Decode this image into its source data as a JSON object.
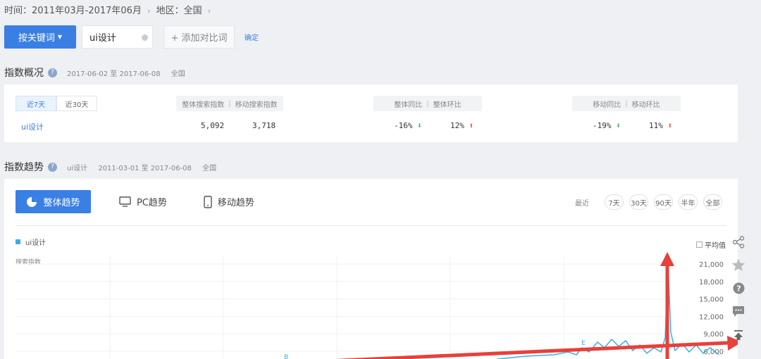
{
  "filter": {
    "time_label": "时间：2011年03月-2017年06月",
    "region_label": "地区：全国",
    "sep": "›"
  },
  "search": {
    "keyword_button": "按关键词",
    "keyword_value": "ui设计",
    "add_compare": "+ 添加对比词",
    "confirm": "确定"
  },
  "overview": {
    "title": "指数概况",
    "date_range": "2017-06-02 至 2017-06-08",
    "region": "全国",
    "tabs": [
      "近7天",
      "近30天"
    ],
    "headers": {
      "search_overall": "整体搜索指数",
      "search_mobile": "移动搜索指数",
      "overall_yoy": "整体同比",
      "overall_mom": "整体环比",
      "mobile_yoy": "移动同比",
      "mobile_mom": "移动环比",
      "bar": "|"
    },
    "row": {
      "keyword": "ui设计",
      "overall_index": "5,092",
      "mobile_index": "3,718",
      "overall_yoy": "-16%",
      "overall_mom": "12%",
      "mobile_yoy": "-19%",
      "mobile_mom": "11%"
    },
    "arrows": {
      "down": "⬇",
      "up": "⬆"
    }
  },
  "trend": {
    "title": "指数趋势",
    "keyword": "ui设计",
    "date_range": "2011-03-01 至 2017-06-08",
    "region": "全国",
    "tabs": [
      "整体趋势",
      "PC趋势",
      "移动趋势"
    ],
    "range_label": "最近",
    "ranges": [
      "7天",
      "30天",
      "90天",
      "半年",
      "全部"
    ],
    "legend": "ui设计",
    "y_title": "搜索指数",
    "avg_label": "平均值",
    "marker_e": "E",
    "marker_b": "B"
  },
  "chart_data": {
    "type": "line",
    "series": [
      {
        "name": "ui设计",
        "color": "#3ab0e2"
      }
    ],
    "y_ticks": [
      "21,000",
      "18,000",
      "15,000",
      "12,000",
      "9,000",
      "6,000"
    ],
    "ylabel": "搜索指数",
    "ylim": [
      6000,
      22000
    ],
    "grid": true
  },
  "side_tools": [
    "share-icon",
    "star-icon",
    "help-icon",
    "comment-icon",
    "back-to-top-icon"
  ],
  "colors": {
    "accent": "#3a7fe4",
    "line": "#3ab0e2",
    "annotation": "#e8403a",
    "down": "#2fb34a",
    "up": "#f0462c"
  }
}
